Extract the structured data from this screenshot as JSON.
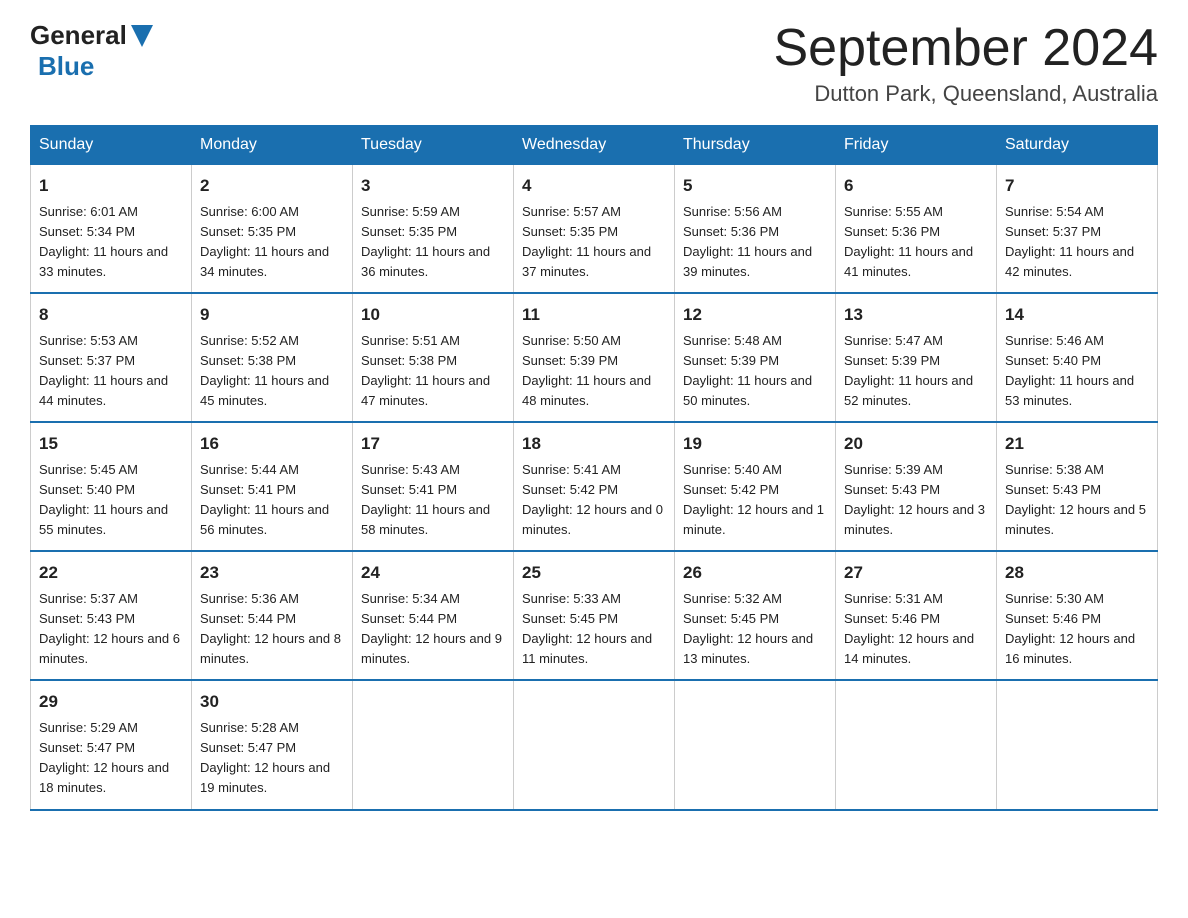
{
  "header": {
    "logo_general": "General",
    "logo_blue": "Blue",
    "month_title": "September 2024",
    "location": "Dutton Park, Queensland, Australia"
  },
  "days_of_week": [
    "Sunday",
    "Monday",
    "Tuesday",
    "Wednesday",
    "Thursday",
    "Friday",
    "Saturday"
  ],
  "weeks": [
    [
      {
        "day": "1",
        "sunrise": "6:01 AM",
        "sunset": "5:34 PM",
        "daylight": "11 hours and 33 minutes."
      },
      {
        "day": "2",
        "sunrise": "6:00 AM",
        "sunset": "5:35 PM",
        "daylight": "11 hours and 34 minutes."
      },
      {
        "day": "3",
        "sunrise": "5:59 AM",
        "sunset": "5:35 PM",
        "daylight": "11 hours and 36 minutes."
      },
      {
        "day": "4",
        "sunrise": "5:57 AM",
        "sunset": "5:35 PM",
        "daylight": "11 hours and 37 minutes."
      },
      {
        "day": "5",
        "sunrise": "5:56 AM",
        "sunset": "5:36 PM",
        "daylight": "11 hours and 39 minutes."
      },
      {
        "day": "6",
        "sunrise": "5:55 AM",
        "sunset": "5:36 PM",
        "daylight": "11 hours and 41 minutes."
      },
      {
        "day": "7",
        "sunrise": "5:54 AM",
        "sunset": "5:37 PM",
        "daylight": "11 hours and 42 minutes."
      }
    ],
    [
      {
        "day": "8",
        "sunrise": "5:53 AM",
        "sunset": "5:37 PM",
        "daylight": "11 hours and 44 minutes."
      },
      {
        "day": "9",
        "sunrise": "5:52 AM",
        "sunset": "5:38 PM",
        "daylight": "11 hours and 45 minutes."
      },
      {
        "day": "10",
        "sunrise": "5:51 AM",
        "sunset": "5:38 PM",
        "daylight": "11 hours and 47 minutes."
      },
      {
        "day": "11",
        "sunrise": "5:50 AM",
        "sunset": "5:39 PM",
        "daylight": "11 hours and 48 minutes."
      },
      {
        "day": "12",
        "sunrise": "5:48 AM",
        "sunset": "5:39 PM",
        "daylight": "11 hours and 50 minutes."
      },
      {
        "day": "13",
        "sunrise": "5:47 AM",
        "sunset": "5:39 PM",
        "daylight": "11 hours and 52 minutes."
      },
      {
        "day": "14",
        "sunrise": "5:46 AM",
        "sunset": "5:40 PM",
        "daylight": "11 hours and 53 minutes."
      }
    ],
    [
      {
        "day": "15",
        "sunrise": "5:45 AM",
        "sunset": "5:40 PM",
        "daylight": "11 hours and 55 minutes."
      },
      {
        "day": "16",
        "sunrise": "5:44 AM",
        "sunset": "5:41 PM",
        "daylight": "11 hours and 56 minutes."
      },
      {
        "day": "17",
        "sunrise": "5:43 AM",
        "sunset": "5:41 PM",
        "daylight": "11 hours and 58 minutes."
      },
      {
        "day": "18",
        "sunrise": "5:41 AM",
        "sunset": "5:42 PM",
        "daylight": "12 hours and 0 minutes."
      },
      {
        "day": "19",
        "sunrise": "5:40 AM",
        "sunset": "5:42 PM",
        "daylight": "12 hours and 1 minute."
      },
      {
        "day": "20",
        "sunrise": "5:39 AM",
        "sunset": "5:43 PM",
        "daylight": "12 hours and 3 minutes."
      },
      {
        "day": "21",
        "sunrise": "5:38 AM",
        "sunset": "5:43 PM",
        "daylight": "12 hours and 5 minutes."
      }
    ],
    [
      {
        "day": "22",
        "sunrise": "5:37 AM",
        "sunset": "5:43 PM",
        "daylight": "12 hours and 6 minutes."
      },
      {
        "day": "23",
        "sunrise": "5:36 AM",
        "sunset": "5:44 PM",
        "daylight": "12 hours and 8 minutes."
      },
      {
        "day": "24",
        "sunrise": "5:34 AM",
        "sunset": "5:44 PM",
        "daylight": "12 hours and 9 minutes."
      },
      {
        "day": "25",
        "sunrise": "5:33 AM",
        "sunset": "5:45 PM",
        "daylight": "12 hours and 11 minutes."
      },
      {
        "day": "26",
        "sunrise": "5:32 AM",
        "sunset": "5:45 PM",
        "daylight": "12 hours and 13 minutes."
      },
      {
        "day": "27",
        "sunrise": "5:31 AM",
        "sunset": "5:46 PM",
        "daylight": "12 hours and 14 minutes."
      },
      {
        "day": "28",
        "sunrise": "5:30 AM",
        "sunset": "5:46 PM",
        "daylight": "12 hours and 16 minutes."
      }
    ],
    [
      {
        "day": "29",
        "sunrise": "5:29 AM",
        "sunset": "5:47 PM",
        "daylight": "12 hours and 18 minutes."
      },
      {
        "day": "30",
        "sunrise": "5:28 AM",
        "sunset": "5:47 PM",
        "daylight": "12 hours and 19 minutes."
      },
      null,
      null,
      null,
      null,
      null
    ]
  ]
}
